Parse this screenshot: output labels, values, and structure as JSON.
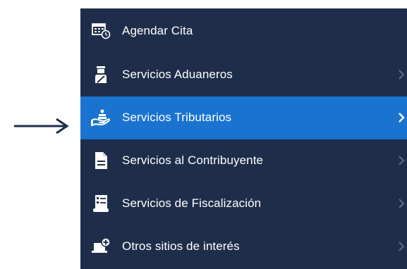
{
  "menu": {
    "items": [
      {
        "label": "Agendar Cita",
        "icon": "calendar-clock-icon",
        "has_submenu": false,
        "active": false
      },
      {
        "label": "Servicios Aduaneros",
        "icon": "customs-officer-icon",
        "has_submenu": true,
        "active": false
      },
      {
        "label": "Servicios Tributarios",
        "icon": "hand-coins-icon",
        "has_submenu": true,
        "active": true
      },
      {
        "label": "Servicios al Contribuyente",
        "icon": "document-icon",
        "has_submenu": true,
        "active": false
      },
      {
        "label": "Servicios de Fiscalización",
        "icon": "checklist-scroll-icon",
        "has_submenu": true,
        "active": false
      },
      {
        "label": "Otros sitios de interés",
        "icon": "laptop-add-icon",
        "has_submenu": true,
        "active": false
      }
    ]
  },
  "colors": {
    "menu_background": "#1e2e4a",
    "active_background": "#1b73d0",
    "text": "#ffffff",
    "pointer_arrow": "#1e2e4a"
  }
}
